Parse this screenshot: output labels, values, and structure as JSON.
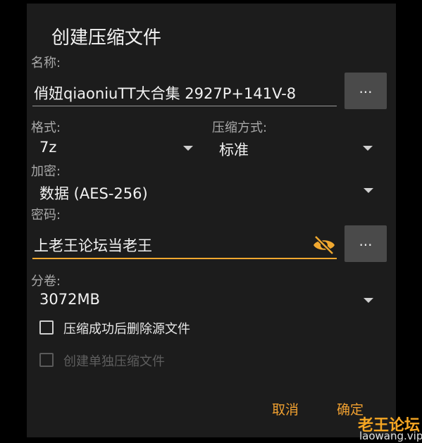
{
  "dialog": {
    "title": "创建压缩文件",
    "name_label": "名称:",
    "name_value": "俏妞qiaoniuTT大合集  2927P+141V-8",
    "browse_label": "...",
    "format_label": "格式:",
    "format_value": "7z",
    "method_label": "压缩方式:",
    "method_value": "标准",
    "encryption_label": "加密:",
    "encryption_value": "数据 (AES-256)",
    "password_label": "密码:",
    "password_value": "上老王论坛当老王",
    "password_more_label": "...",
    "split_label": "分卷:",
    "split_value": "3072MB",
    "delete_source_label": "压缩成功后删除源文件",
    "separate_archives_label": "创建单独压缩文件",
    "cancel_label": "取消",
    "ok_label": "确定"
  },
  "watermark": {
    "main": "老王论坛",
    "sub": "laowang.vip"
  },
  "colors": {
    "background": "#000000",
    "dialog": "#1c1c1c",
    "accent": "#f0a830",
    "button": "#4a4a4a"
  }
}
